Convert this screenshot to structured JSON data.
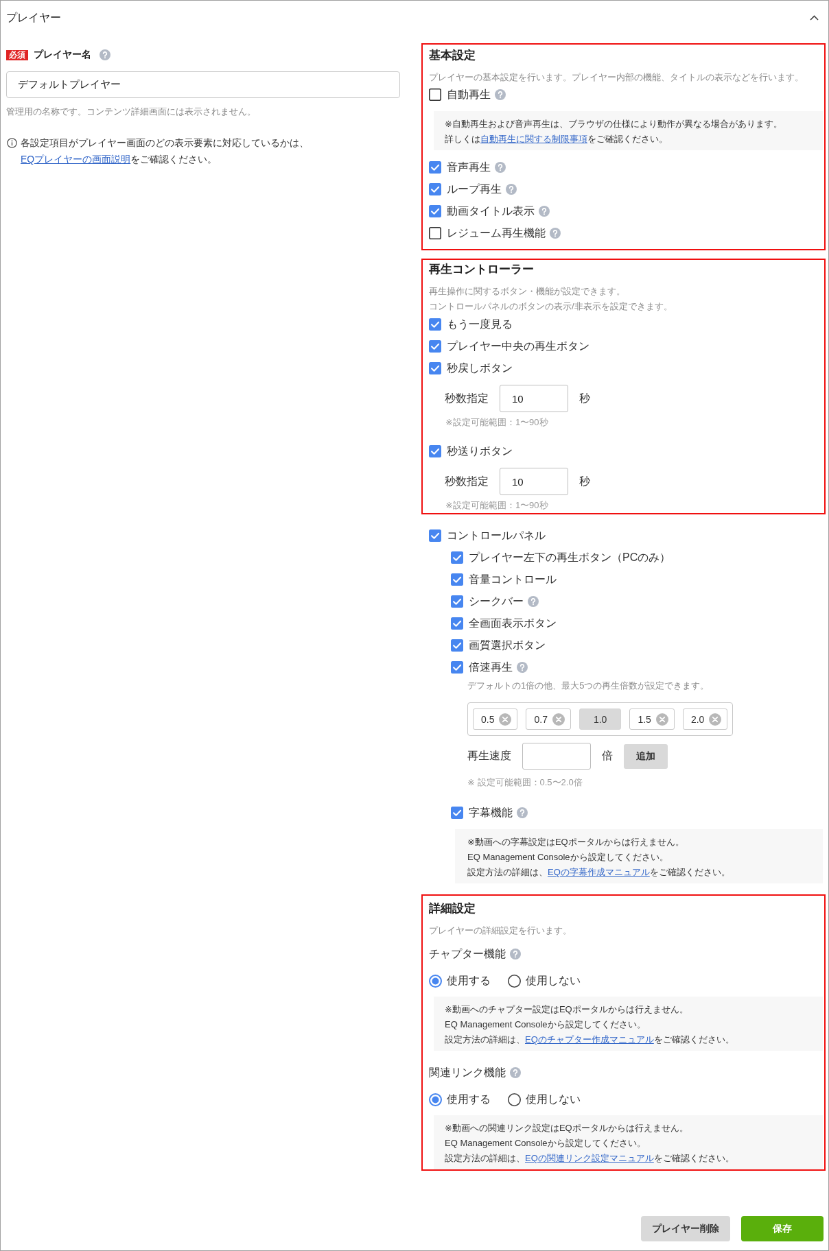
{
  "header": {
    "title": "プレイヤー"
  },
  "player_name": {
    "badge": "必須",
    "label": "プレイヤー名",
    "help": true,
    "value": "デフォルトプレイヤー",
    "hint": "管理用の名称です。コンテンツ詳細画面には表示されません。"
  },
  "info": {
    "text": "各設定項目がプレイヤー画面のどの表示要素に対応しているかは、",
    "link": "EQプレイヤーの画面説明",
    "after": "をご確認ください。"
  },
  "basic_settings": {
    "highlighted": true,
    "title": "基本設定",
    "description": [
      "プレイヤーの基本設定を行います。プレイヤー内部の機能、タイトルの表示などを行います。"
    ],
    "items": [
      {
        "label": "自動再生",
        "checked": false,
        "help": true,
        "note": [
          {
            "text": "※自動再生および音声再生は、ブラウザの仕様により動作が異なる場合があります。"
          },
          {
            "text": "詳しくは",
            "link": "自動再生に関する制限事項",
            "after": "をご確認ください。"
          }
        ]
      },
      {
        "label": "音声再生",
        "checked": true,
        "help": true
      },
      {
        "label": "ループ再生",
        "checked": true,
        "help": true
      },
      {
        "label": "動画タイトル表示",
        "checked": true,
        "help": true
      },
      {
        "label": "レジューム再生機能",
        "checked": false,
        "help": true
      }
    ]
  },
  "playback_controller": {
    "highlighted": true,
    "title": "再生コントローラー",
    "description": [
      "再生操作に関するボタン・機能が設定できます。",
      "コントロールパネルのボタンの表示/非表示を設定できます。"
    ],
    "items": [
      {
        "label": "もう一度見る",
        "checked": true,
        "help": false
      },
      {
        "label": "プレイヤー中央の再生ボタン",
        "checked": true,
        "help": false
      },
      {
        "label": "秒戻しボタン",
        "checked": true,
        "help": false,
        "seconds": {
          "label": "秒数指定",
          "value": "10",
          "unit": "秒",
          "note": "※設定可能範囲：1〜90秒"
        }
      },
      {
        "label": "秒送りボタン",
        "checked": true,
        "help": false,
        "seconds": {
          "label": "秒数指定",
          "value": "10",
          "unit": "秒",
          "note": "※設定可能範囲：1〜90秒"
        }
      }
    ]
  },
  "control_panel": {
    "label": "コントロールパネル",
    "checked": true,
    "children": [
      {
        "label": "プレイヤー左下の再生ボタン（PCのみ）",
        "checked": true,
        "help": false
      },
      {
        "label": "音量コントロール",
        "checked": true,
        "help": false
      },
      {
        "label": "シークバー",
        "checked": true,
        "help": true
      },
      {
        "label": "全画面表示ボタン",
        "checked": true,
        "help": false
      },
      {
        "label": "画質選択ボタン",
        "checked": true,
        "help": false
      },
      {
        "label": "倍速再生",
        "checked": true,
        "help": true,
        "speed": {
          "description": "デフォルトの1倍の他、最大5つの再生倍数が設定できます。",
          "tags": [
            {
              "label": "0.5",
              "removable": true
            },
            {
              "label": "0.7",
              "removable": true
            },
            {
              "label": "1.0",
              "removable": false
            },
            {
              "label": "1.5",
              "removable": true
            },
            {
              "label": "2.0",
              "removable": true
            }
          ],
          "add": {
            "label": "再生速度",
            "unit": "倍",
            "button": "追加"
          },
          "note": "※ 設定可能範囲：0.5〜2.0倍"
        }
      },
      {
        "label": "字幕機能",
        "checked": true,
        "help": true,
        "note": [
          {
            "text": "※動画への字幕設定はEQポータルからは行えません。"
          },
          {
            "text": "EQ Management Consoleから設定してください。"
          },
          {
            "text": "設定方法の詳細は、",
            "link": "EQの字幕作成マニュアル",
            "after": "をご確認ください。"
          }
        ]
      }
    ]
  },
  "detail_settings": {
    "highlighted": true,
    "title": "詳細設定",
    "description": [
      "プレイヤーの詳細設定を行います。"
    ],
    "features": [
      {
        "label": "チャプター機能",
        "help": true,
        "options": [
          {
            "label": "使用する",
            "selected": true
          },
          {
            "label": "使用しない",
            "selected": false
          }
        ],
        "note": [
          {
            "text": "※動画へのチャプター設定はEQポータルからは行えません。"
          },
          {
            "text": "EQ Management Consoleから設定してください。"
          },
          {
            "text": "設定方法の詳細は、",
            "link": "EQのチャプター作成マニュアル",
            "after": "をご確認ください。"
          }
        ]
      },
      {
        "label": "関連リンク機能",
        "help": true,
        "options": [
          {
            "label": "使用する",
            "selected": true
          },
          {
            "label": "使用しない",
            "selected": false
          }
        ],
        "note": [
          {
            "text": "※動画への関連リンク設定はEQポータルからは行えません。"
          },
          {
            "text": "EQ Management Consoleから設定してください。"
          },
          {
            "text": "設定方法の詳細は、",
            "link": "EQの関連リンク設定マニュアル",
            "after": "をご確認ください。"
          }
        ]
      }
    ]
  },
  "footer": {
    "buttons": [
      {
        "label": "プレイヤー削除",
        "kind": "secondary"
      },
      {
        "label": "保存",
        "kind": "primary"
      }
    ]
  }
}
